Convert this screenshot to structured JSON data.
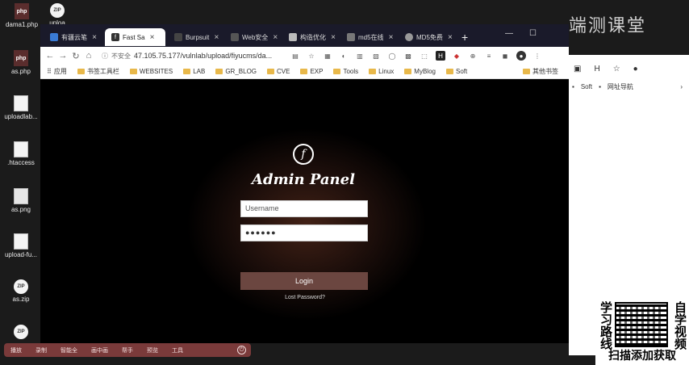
{
  "desktop": {
    "icons": [
      {
        "label": "dama1.php",
        "icon": "php-file-icon"
      },
      {
        "label": "uploa",
        "icon": "zip-icon"
      },
      {
        "label": "as.php",
        "icon": "php-file-icon"
      },
      {
        "label": "uploadlab...",
        "icon": "file-icon"
      },
      {
        "label": ".htaccess",
        "icon": "file-icon"
      },
      {
        "label": "as.png",
        "icon": "image-icon"
      },
      {
        "label": "upload-fu...",
        "icon": "file-icon"
      },
      {
        "label": "as.zip",
        "icon": "zip-icon"
      }
    ]
  },
  "browser": {
    "tabs": [
      {
        "label": "有疆云笔"
      },
      {
        "label": "Fast Sa",
        "active": true
      },
      {
        "label": "Burpsuit"
      },
      {
        "label": "Web安全"
      },
      {
        "label": "构造优化"
      },
      {
        "label": "md5在线"
      },
      {
        "label": "MD5免费"
      }
    ],
    "security_label": "不安全",
    "url": "47.105.75.177/vulnlab/upload/fiyucms/da...",
    "bookmarks": [
      "应用",
      "书签工具栏",
      "WEBSITES",
      "LAB",
      "GR_BLOG",
      "CVE",
      "EXP",
      "Tools",
      "Linux",
      "MyBlog",
      "Soft",
      "其他书签"
    ]
  },
  "page": {
    "logo_letter": "f",
    "title": "Admin Panel",
    "username_placeholder": "Username",
    "password_value": "●●●●●●",
    "login_label": "Login",
    "lost_password": "Lost Password?"
  },
  "right_window": {
    "watermark": "端测课堂",
    "bookmarks": [
      "Soft",
      "网址导航"
    ]
  },
  "ad": {
    "left_text": "学习路线",
    "right_text": "自学视频",
    "caption": "扫描添加获取"
  },
  "taskbar": {
    "items": [
      "播放",
      "录制",
      "智能全",
      "画中画",
      "帮手",
      "预览",
      "工具"
    ]
  }
}
